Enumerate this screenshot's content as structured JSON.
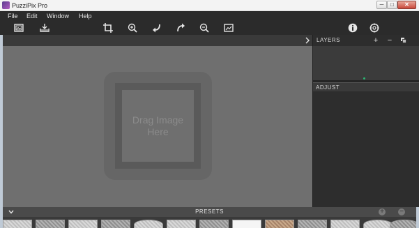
{
  "window": {
    "title": "PuzziPix Pro",
    "controls": {
      "minimize": "─",
      "maximize": "□",
      "close": "✕"
    }
  },
  "menu": {
    "items": [
      {
        "label": "File"
      },
      {
        "label": "Edit"
      },
      {
        "label": "Window"
      },
      {
        "label": "Help"
      }
    ]
  },
  "toolbar": {
    "icons": [
      "open-image-icon",
      "save-icon",
      "crop-icon",
      "zoom-in-icon",
      "undo-icon",
      "redo-icon",
      "zoom-out-icon",
      "fit-image-icon",
      "info-icon",
      "settings-icon"
    ]
  },
  "canvas": {
    "drop_text_line1": "Drag Image",
    "drop_text_line2": "Here"
  },
  "layers": {
    "title": "LAYERS",
    "add_label": "+",
    "remove_label": "−"
  },
  "adjust": {
    "title": "ADJUST"
  },
  "presets": {
    "title": "PRESETS",
    "add_label": "+",
    "remove_label": "−"
  },
  "colors": {
    "background": "#2b2b2b",
    "canvas": "#6f6f6f",
    "accent": "#2bb673"
  }
}
